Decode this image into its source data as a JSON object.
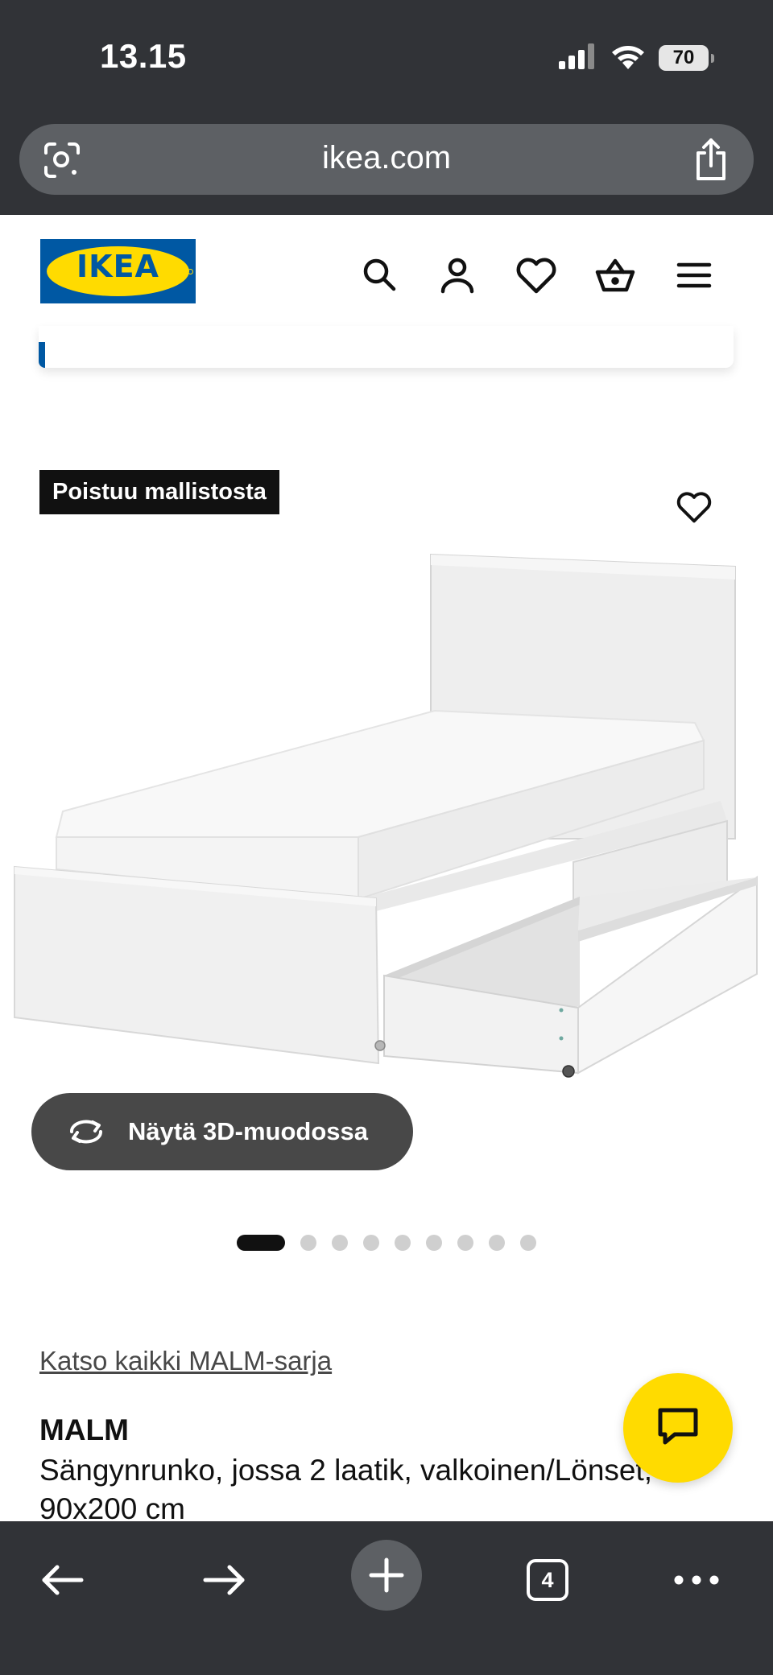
{
  "status_bar": {
    "time": "13.15",
    "battery": "70",
    "icons": [
      "cellular-signal-icon",
      "wifi-icon",
      "battery-icon"
    ]
  },
  "browser": {
    "url": "ikea.com",
    "icons": [
      "lens-icon",
      "share-icon"
    ]
  },
  "header": {
    "logo_text": "IKEA",
    "icons": [
      "search-icon",
      "account-icon",
      "heart-icon",
      "basket-icon",
      "menu-icon"
    ]
  },
  "product": {
    "badge": "Poistuu mallistosta",
    "view_3d_label": "Näytä 3D-muodossa",
    "image_count": 9,
    "active_image": 1,
    "series_link": "Katso kaikki MALM-sarja",
    "name": "MALM",
    "description": "Sängynrunko, jossa 2 laatik, valkoinen/Lönset, 90x200 cm"
  },
  "bottom_bar": {
    "tab_count": "4",
    "icons": [
      "back-arrow-icon",
      "forward-arrow-icon",
      "new-tab-icon",
      "tabs-icon",
      "more-icon"
    ]
  },
  "colors": {
    "ikea_blue": "#0058a3",
    "ikea_yellow": "#ffdb00",
    "browser_chrome": "#313337",
    "badge_bg": "#111111",
    "button_dark": "#484848"
  }
}
